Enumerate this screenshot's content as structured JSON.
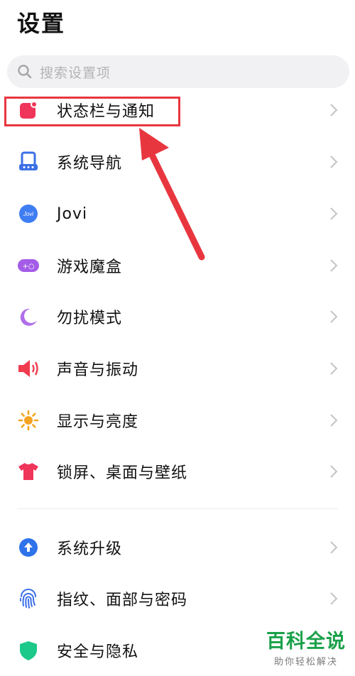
{
  "page_title": "设置",
  "search": {
    "placeholder": "搜索设置项"
  },
  "items": [
    {
      "label": "状态栏与通知",
      "icon": "status-bar-notification-icon",
      "color": "#f0355a"
    },
    {
      "label": "系统导航",
      "icon": "system-navigation-icon",
      "color": "#3b6fe6"
    },
    {
      "label": "Jovi",
      "icon": "jovi-icon",
      "icon_text": "Jovi",
      "color": "#3f7df2"
    },
    {
      "label": "游戏魔盒",
      "icon": "game-box-icon",
      "icon_text": "+○",
      "color": "#a45ce8"
    },
    {
      "label": "勿扰模式",
      "icon": "moon-icon",
      "color": "#b06ee8"
    },
    {
      "label": "声音与振动",
      "icon": "speaker-icon",
      "color": "#f03b4e"
    },
    {
      "label": "显示与亮度",
      "icon": "sun-icon",
      "color": "#f5a323"
    },
    {
      "label": "锁屏、桌面与壁纸",
      "icon": "tshirt-icon",
      "color": "#f0355a"
    },
    {
      "label": "系统升级",
      "icon": "upgrade-arrow-icon",
      "color": "#2f73ea"
    },
    {
      "label": "指纹、面部与密码",
      "icon": "fingerprint-icon",
      "color": "#3b6fe6"
    },
    {
      "label": "安全与隐私",
      "icon": "shield-icon",
      "color": "#1cc88a"
    }
  ],
  "watermark": {
    "main": "百科全说",
    "sub": "助你轻松解决"
  },
  "colors": {
    "highlight": "#e8363f",
    "chevron": "#c4c4c8"
  }
}
